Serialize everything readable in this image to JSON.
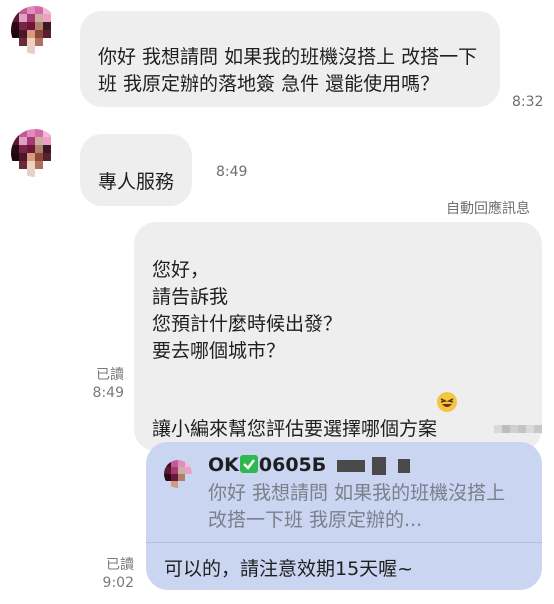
{
  "messages": {
    "incoming_1": {
      "text": "你好 我想請問 如果我的班機沒搭上 改搭一下班 我原定辦的落地簽 急件 還能使用嗎？",
      "time": "8:32"
    },
    "incoming_2": {
      "text": "專人服務",
      "time": "8:49"
    },
    "auto_reply": {
      "label": "自動回應訊息",
      "text": "您好，\n請告訴我\n您預計什麼時候出發？\n要去哪個城市？\n\n讓小編來幫您評估要選擇哪個方案",
      "emoji": "laughing-face-emoji",
      "read_label": "已讀",
      "time": "8:49"
    },
    "reply": {
      "quote_name_prefix": "OK",
      "quote_name_suffix": "0605Б",
      "quote_icon": "green-check-emoji",
      "quote_text": "你好 我想請問 如果我的班機沒搭上 改搭一下班 我原定辦的...",
      "text": "可以的，請注意效期15天喔~",
      "read_label": "已讀",
      "time": "9:02"
    }
  },
  "colors": {
    "incoming_bubble": "#eeeeee",
    "outgoing_bubble": "#eeeeee",
    "reply_bubble": "#c9d5f1",
    "check_green": "#2fb84f"
  }
}
